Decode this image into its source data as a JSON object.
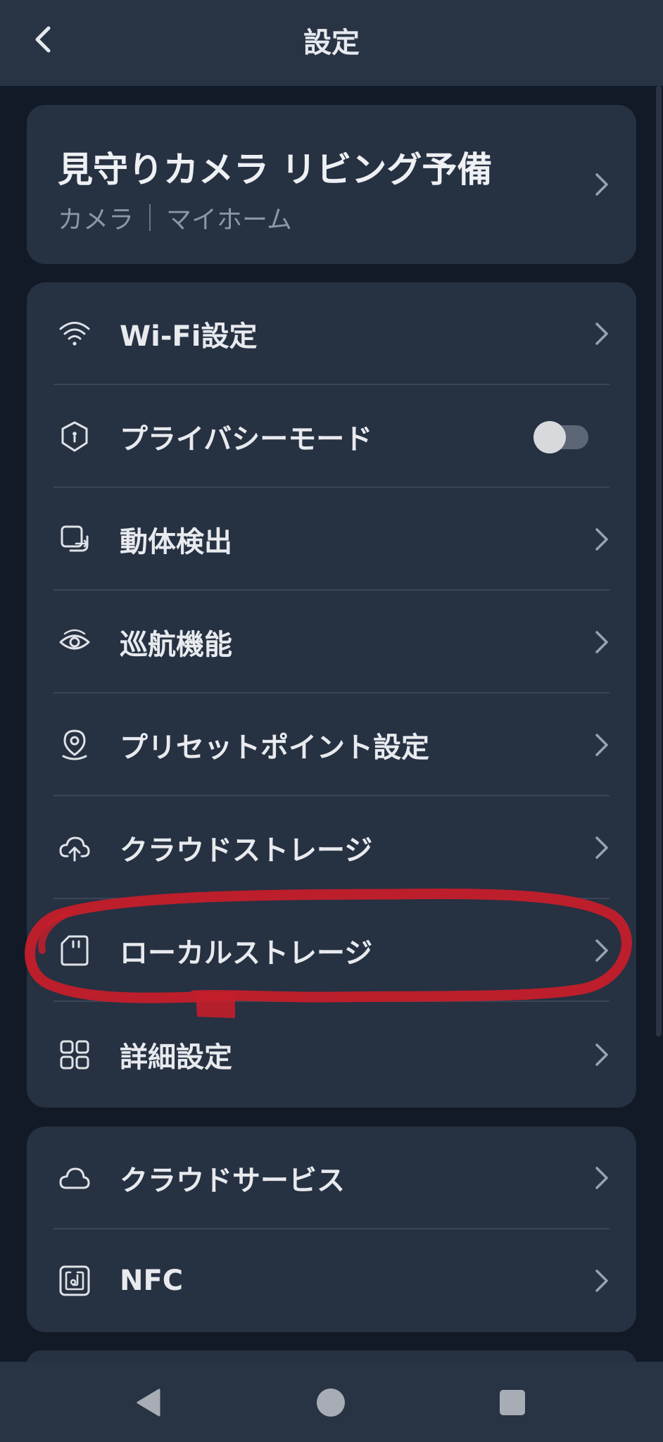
{
  "header": {
    "title": "設定",
    "back_icon": "chevron-left-icon"
  },
  "device": {
    "name": "見守りカメラ リビング予備",
    "type": "カメラ",
    "home": "マイホーム"
  },
  "menu": [
    {
      "label": "Wi-Fi設定",
      "icon": "wifi-icon"
    },
    {
      "label": "プライバシーモード",
      "icon": "shield-icon",
      "toggle": false
    },
    {
      "label": "動体検出",
      "icon": "motion-detect-icon"
    },
    {
      "label": "巡航機能",
      "icon": "patrol-eye-icon"
    },
    {
      "label": "プリセットポイント設定",
      "icon": "location-pin-icon"
    },
    {
      "label": "クラウドストレージ",
      "icon": "cloud-upload-icon"
    },
    {
      "label": "ローカルストレージ",
      "icon": "sd-card-icon"
    },
    {
      "label": "詳細設定",
      "icon": "grid-icon"
    }
  ],
  "services": [
    {
      "label": "クラウドサービス",
      "icon": "cloud-icon"
    },
    {
      "label": "NFC",
      "icon": "nfc-icon"
    }
  ],
  "annotation": {
    "color": "#c41e2a",
    "target": "ローカルストレージ"
  },
  "colors": {
    "background": "#111a26",
    "card": "#263142",
    "header": "#283344",
    "text": "#e8eaee",
    "subtext": "#8d96a3"
  }
}
